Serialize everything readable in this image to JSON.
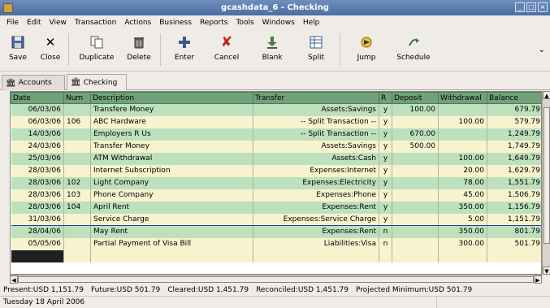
{
  "window": {
    "title": "gcashdata_6 - Checking"
  },
  "menu": [
    "File",
    "Edit",
    "View",
    "Transaction",
    "Actions",
    "Business",
    "Reports",
    "Tools",
    "Windows",
    "Help"
  ],
  "toolbar": {
    "save": "Save",
    "close": "Close",
    "duplicate": "Duplicate",
    "delete": "Delete",
    "enter": "Enter",
    "cancel": "Cancel",
    "blank": "Blank",
    "split": "Split",
    "jump": "Jump",
    "schedule": "Schedule"
  },
  "tabs": {
    "accounts": "Accounts",
    "checking": "Checking"
  },
  "register": {
    "columns": [
      "Date",
      "Num",
      "Description",
      "Transfer",
      "R",
      "Deposit",
      "Withdrawal",
      "Balance"
    ],
    "rows": [
      {
        "date": "06/03/06",
        "num": "",
        "desc": "Transfere Money",
        "transfer": "Assets:Savings",
        "r": "y",
        "deposit": "100.00",
        "withdrawal": "",
        "balance": "679.79"
      },
      {
        "date": "06/03/06",
        "num": "106",
        "desc": "ABC Hardware",
        "transfer": "-- Split Transaction --",
        "r": "y",
        "deposit": "",
        "withdrawal": "100.00",
        "balance": "579.79"
      },
      {
        "date": "14/03/06",
        "num": "",
        "desc": "Employers R Us",
        "transfer": "-- Split Transaction --",
        "r": "y",
        "deposit": "670.00",
        "withdrawal": "",
        "balance": "1,249.79"
      },
      {
        "date": "24/03/06",
        "num": "",
        "desc": "Transfer Money",
        "transfer": "Assets:Savings",
        "r": "y",
        "deposit": "500.00",
        "withdrawal": "",
        "balance": "1,749.79"
      },
      {
        "date": "25/03/06",
        "num": "",
        "desc": "ATM Withdrawal",
        "transfer": "Assets:Cash",
        "r": "y",
        "deposit": "",
        "withdrawal": "100.00",
        "balance": "1,649.79"
      },
      {
        "date": "28/03/06",
        "num": "",
        "desc": "Internet Subscription",
        "transfer": "Expenses:Internet",
        "r": "y",
        "deposit": "",
        "withdrawal": "20.00",
        "balance": "1,629.79"
      },
      {
        "date": "28/03/06",
        "num": "102",
        "desc": "Light Company",
        "transfer": "Expenses:Electricity",
        "r": "y",
        "deposit": "",
        "withdrawal": "78.00",
        "balance": "1,551.79"
      },
      {
        "date": "28/03/06",
        "num": "103",
        "desc": "Phone Company",
        "transfer": "Expenses:Phone",
        "r": "y",
        "deposit": "",
        "withdrawal": "45.00",
        "balance": "1,506.79"
      },
      {
        "date": "28/03/06",
        "num": "104",
        "desc": "April Rent",
        "transfer": "Expenses:Rent",
        "r": "y",
        "deposit": "",
        "withdrawal": "350.00",
        "balance": "1,156.79"
      },
      {
        "date": "31/03/06",
        "num": "",
        "desc": "Service Charge",
        "transfer": "Expenses:Service Charge",
        "r": "y",
        "deposit": "",
        "withdrawal": "5.00",
        "balance": "1,151.79"
      },
      {
        "date": "28/04/06",
        "num": "",
        "desc": "May Rent",
        "transfer": "Expenses:Rent",
        "r": "n",
        "deposit": "",
        "withdrawal": "350.00",
        "balance": "801.79"
      },
      {
        "date": "05/05/06",
        "num": "",
        "desc": "Partial Payment of Visa Bill",
        "transfer": "Liabilities:Visa",
        "r": "n",
        "deposit": "",
        "withdrawal": "300.00",
        "balance": "501.79"
      }
    ]
  },
  "summary": {
    "present": "Present:USD 1,151.79",
    "future": "Future:USD 501.79",
    "cleared": "Cleared:USD 1,451.79",
    "reconciled": "Reconciled:USD 1,451.79",
    "projected": "Projected Minimum:USD 501.79"
  },
  "status": {
    "date": "Tuesday 18 April 2006"
  },
  "colors": {
    "green_row": "#bde0bd",
    "yellow_row": "#f7f3cf",
    "header": "#70a27a",
    "titlebar": "#4a6ea3"
  }
}
